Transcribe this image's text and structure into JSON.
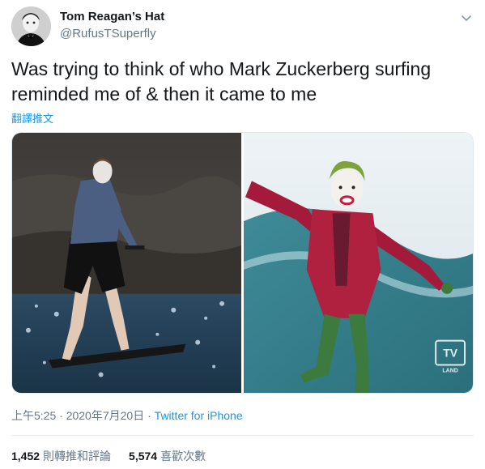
{
  "author": {
    "display_name": "Tom Reagan’s Hat",
    "handle": "@RufusTSuperfly",
    "avatar_icon": "user-avatar"
  },
  "tweet": {
    "text": "Was trying to think of who Mark Zuckerberg surfing\nreminded me of & then it came to me",
    "translate_label": "翻譯推文"
  },
  "media": {
    "photos": [
      {
        "icon": "surfing-photo"
      },
      {
        "icon": "joker-surfing-photo",
        "watermark": "TV LAND"
      }
    ]
  },
  "meta": {
    "time": "上午5:25",
    "separator": " · ",
    "date": "2020年7月20日",
    "source": "Twitter for iPhone"
  },
  "stats": {
    "retweets_count": "1,452",
    "retweets_label": "則轉推和評論",
    "likes_count": "5,574",
    "likes_label": "喜歡次數"
  },
  "colors": {
    "link": "#1b95e0",
    "secondary": "#657786",
    "primary": "#14171a"
  }
}
